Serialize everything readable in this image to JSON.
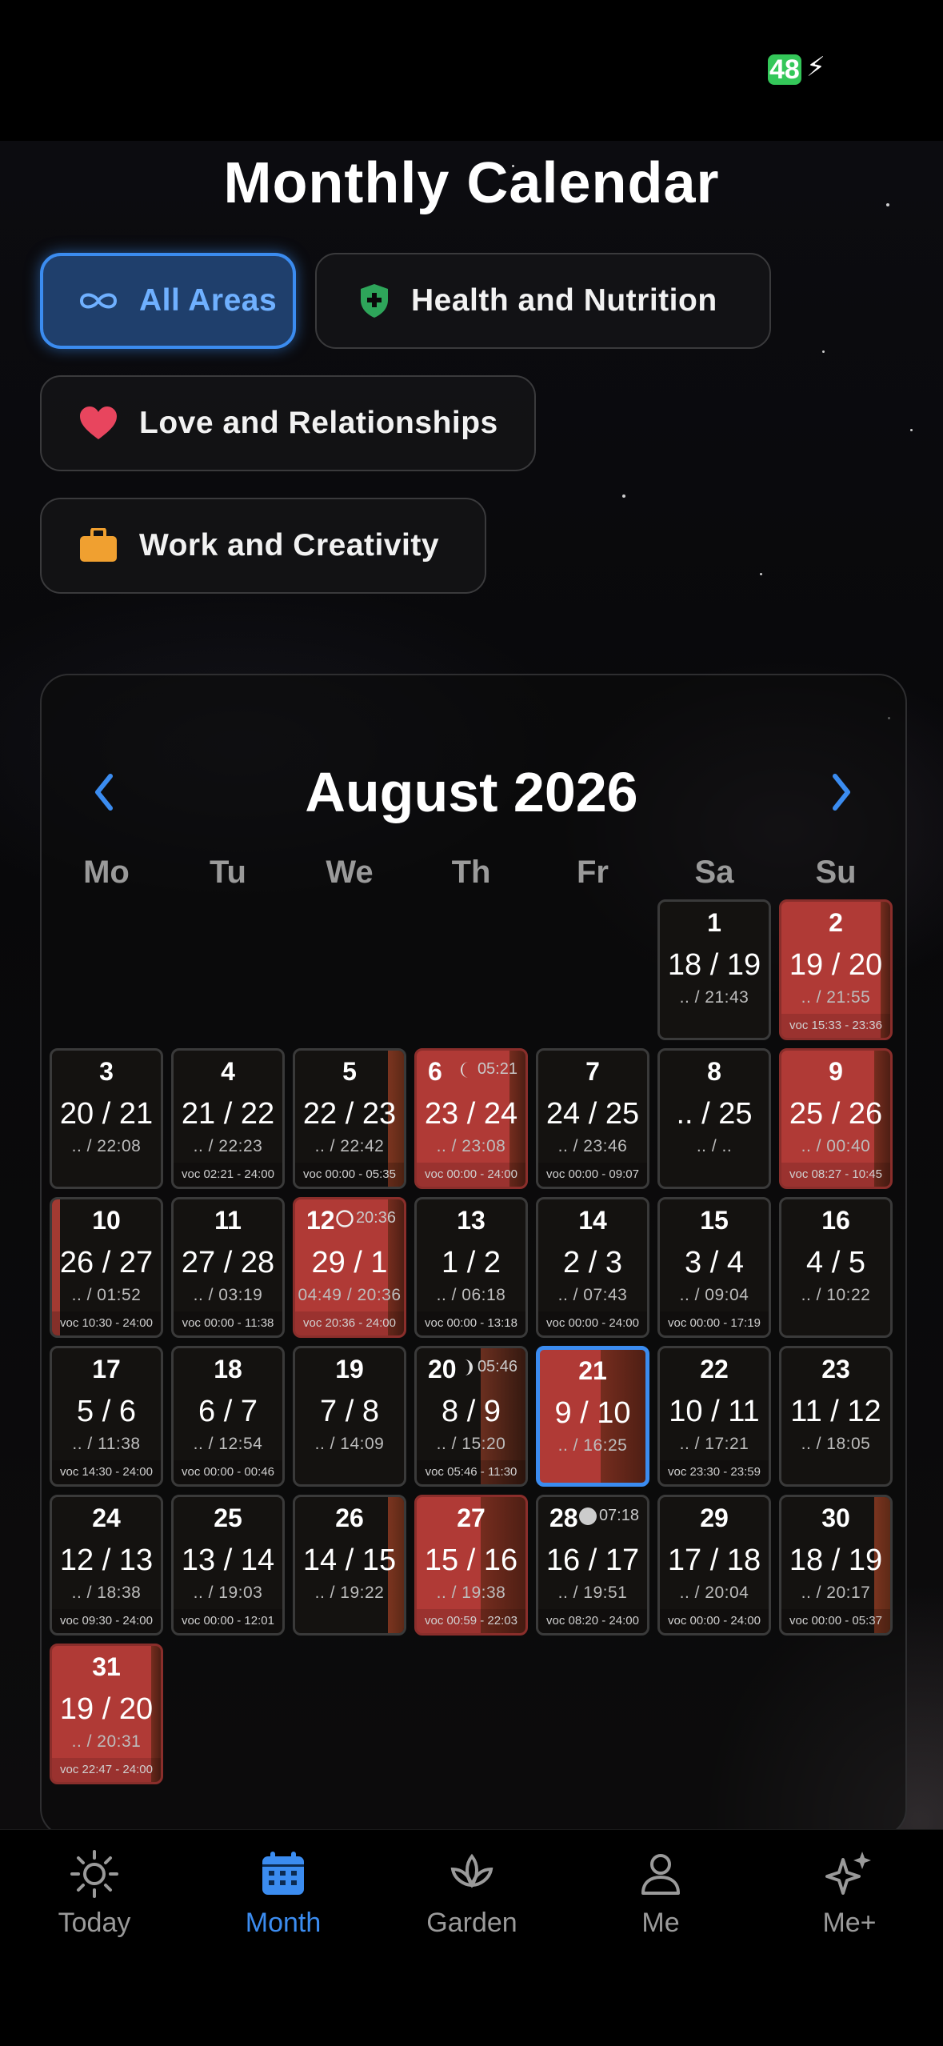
{
  "status_bar": {
    "battery": "48"
  },
  "page_title": "Monthly Calendar",
  "filters": [
    {
      "label": "All Areas",
      "icon": "infinity-icon",
      "active": true
    },
    {
      "label": "Health and Nutrition",
      "icon": "shield-plus-icon",
      "active": false
    },
    {
      "label": "Love and Relationships",
      "icon": "heart-icon",
      "active": false
    },
    {
      "label": "Work and Creativity",
      "icon": "briefcase-icon",
      "active": false
    }
  ],
  "calendar": {
    "month_label": "August 2026",
    "weekdays": [
      "Mo",
      "Tu",
      "We",
      "Th",
      "Fr",
      "Sa",
      "Su"
    ],
    "days": [
      {
        "day": "1",
        "ang": "18 / 19",
        "sub": ".. / 21:43",
        "voc": "",
        "red": false,
        "moon": "",
        "mtime": ""
      },
      {
        "day": "2",
        "ang": "19 / 20",
        "sub": ".. / 21:55",
        "voc": "voc 15:33 - 23:36",
        "red": true,
        "moon": "",
        "mtime": ""
      },
      {
        "day": "3",
        "ang": "20 / 21",
        "sub": ".. / 22:08",
        "voc": "",
        "red": false,
        "moon": "",
        "mtime": ""
      },
      {
        "day": "4",
        "ang": "21 / 22",
        "sub": ".. / 22:23",
        "voc": "voc 02:21 - 24:00",
        "red": false,
        "moon": "",
        "mtime": ""
      },
      {
        "day": "5",
        "ang": "22 / 23",
        "sub": ".. / 22:42",
        "voc": "voc 00:00 - 05:35",
        "red": false,
        "moon": "",
        "mtime": ""
      },
      {
        "day": "6",
        "ang": "23 / 24",
        "sub": ".. / 23:08",
        "voc": "voc 00:00 - 24:00",
        "red": true,
        "moon": "waning",
        "mtime": "05:21"
      },
      {
        "day": "7",
        "ang": "24 / 25",
        "sub": ".. / 23:46",
        "voc": "voc 00:00 - 09:07",
        "red": false,
        "moon": "",
        "mtime": ""
      },
      {
        "day": "8",
        "ang": ".. / 25",
        "sub": ".. / ..",
        "voc": "",
        "red": false,
        "moon": "",
        "mtime": ""
      },
      {
        "day": "9",
        "ang": "25 / 26",
        "sub": ".. / 00:40",
        "voc": "voc 08:27 - 10:45",
        "red": true,
        "moon": "",
        "mtime": ""
      },
      {
        "day": "10",
        "ang": "26 / 27",
        "sub": ".. / 01:52",
        "voc": "voc 10:30 - 24:00",
        "red": false,
        "moon": "",
        "mtime": ""
      },
      {
        "day": "11",
        "ang": "27 / 28",
        "sub": ".. / 03:19",
        "voc": "voc 00:00 - 11:38",
        "red": false,
        "moon": "",
        "mtime": ""
      },
      {
        "day": "12",
        "ang": "29 / 1",
        "sub": "04:49 / 20:36",
        "voc": "voc 20:36 - 24:00",
        "red": true,
        "moon": "new",
        "mtime": "20:36"
      },
      {
        "day": "13",
        "ang": "1 / 2",
        "sub": ".. / 06:18",
        "voc": "voc 00:00 - 13:18",
        "red": false,
        "moon": "",
        "mtime": ""
      },
      {
        "day": "14",
        "ang": "2 / 3",
        "sub": ".. / 07:43",
        "voc": "voc 00:00 - 24:00",
        "red": false,
        "moon": "",
        "mtime": ""
      },
      {
        "day": "15",
        "ang": "3 / 4",
        "sub": ".. / 09:04",
        "voc": "voc 00:00 - 17:19",
        "red": false,
        "moon": "",
        "mtime": ""
      },
      {
        "day": "16",
        "ang": "4 / 5",
        "sub": ".. / 10:22",
        "voc": "",
        "red": false,
        "moon": "",
        "mtime": ""
      },
      {
        "day": "17",
        "ang": "5 / 6",
        "sub": ".. / 11:38",
        "voc": "voc 14:30 - 24:00",
        "red": false,
        "moon": "",
        "mtime": ""
      },
      {
        "day": "18",
        "ang": "6 / 7",
        "sub": ".. / 12:54",
        "voc": "voc 00:00 - 00:46",
        "red": false,
        "moon": "",
        "mtime": ""
      },
      {
        "day": "19",
        "ang": "7 / 8",
        "sub": ".. / 14:09",
        "voc": "",
        "red": false,
        "moon": "",
        "mtime": ""
      },
      {
        "day": "20",
        "ang": "8 / 9",
        "sub": ".. / 15:20",
        "voc": "voc 05:46 - 11:30",
        "red": false,
        "moon": "first-quarter",
        "mtime": "05:46"
      },
      {
        "day": "21",
        "ang": "9 / 10",
        "sub": ".. / 16:25",
        "voc": "",
        "red": true,
        "moon": "",
        "mtime": ""
      },
      {
        "day": "22",
        "ang": "10 / 11",
        "sub": ".. / 17:21",
        "voc": "voc 23:30 - 23:59",
        "red": false,
        "moon": "",
        "mtime": ""
      },
      {
        "day": "23",
        "ang": "11 / 12",
        "sub": ".. / 18:05",
        "voc": "",
        "red": false,
        "moon": "",
        "mtime": ""
      },
      {
        "day": "24",
        "ang": "12 / 13",
        "sub": ".. / 18:38",
        "voc": "voc 09:30 - 24:00",
        "red": false,
        "moon": "",
        "mtime": ""
      },
      {
        "day": "25",
        "ang": "13 / 14",
        "sub": ".. / 19:03",
        "voc": "voc 00:00 - 12:01",
        "red": false,
        "moon": "",
        "mtime": ""
      },
      {
        "day": "26",
        "ang": "14 / 15",
        "sub": ".. / 19:22",
        "voc": "",
        "red": false,
        "moon": "",
        "mtime": ""
      },
      {
        "day": "27",
        "ang": "15 / 16",
        "sub": ".. / 19:38",
        "voc": "voc 00:59 - 22:03",
        "red": true,
        "moon": "",
        "mtime": ""
      },
      {
        "day": "28",
        "ang": "16 / 17",
        "sub": ".. / 19:51",
        "voc": "voc 08:20 - 24:00",
        "red": false,
        "moon": "full",
        "mtime": "07:18"
      },
      {
        "day": "29",
        "ang": "17 / 18",
        "sub": ".. / 20:04",
        "voc": "voc 00:00 - 24:00",
        "red": false,
        "moon": "",
        "mtime": ""
      },
      {
        "day": "30",
        "ang": "18 / 19",
        "sub": ".. / 20:17",
        "voc": "voc 00:00 - 05:37",
        "red": false,
        "moon": "",
        "mtime": ""
      },
      {
        "day": "31",
        "ang": "19 / 20",
        "sub": ".. / 20:31",
        "voc": "voc 22:47 - 24:00",
        "red": true,
        "moon": "",
        "mtime": ""
      }
    ]
  },
  "tab_bar": [
    {
      "label": "Today",
      "icon": "sun-icon",
      "active": false
    },
    {
      "label": "Month",
      "icon": "calendar-icon",
      "active": true
    },
    {
      "label": "Garden",
      "icon": "lotus-icon",
      "active": false
    },
    {
      "label": "Me",
      "icon": "person-icon",
      "active": false
    },
    {
      "label": "Me+",
      "icon": "sparkles-icon",
      "active": false
    }
  ],
  "colors": {
    "accent": "#3b8cf0",
    "red_day": "#b03a36",
    "battery": "#34c759"
  }
}
